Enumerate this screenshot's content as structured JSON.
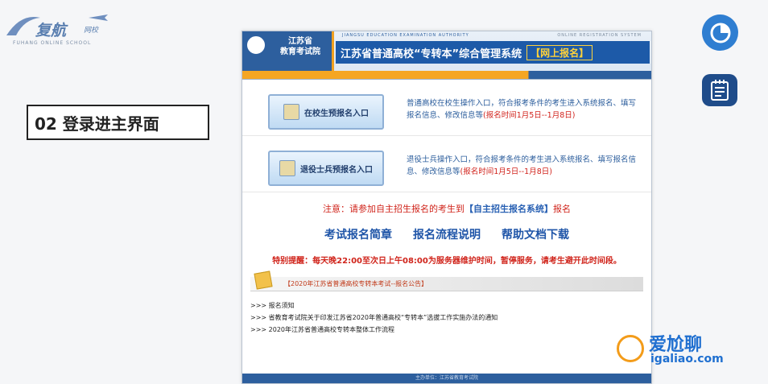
{
  "logo": {
    "brand": "复航",
    "badge": "网校",
    "sub": "FUHANG ONLINE SCHOOL"
  },
  "step_label": "02 登录进主界面",
  "header": {
    "org_line1": "江苏省",
    "org_line2": "教育考试院",
    "eng_left": "JIANGSU EDUCATION EXAMINATION AUTHORITY",
    "eng_right": "ONLINE REGISTRATION SYSTEM",
    "title": "江苏省普通高校“专转本”综合管理系统",
    "online_tag": "【网上报名】"
  },
  "entries": [
    {
      "label": "在校生预报名入口",
      "desc": "普通高校在校生操作入口，符合报考条件的考生进入系统报名、填写报名信息、修改信息等",
      "time": "(报名时间1月5日--1月8日)"
    },
    {
      "label": "退役士兵预报名入口",
      "desc": "退役士兵操作入口，符合报考条件的考生进入系统报名、填写报名信息、修改信息等",
      "time": "(报名时间1月5日--1月8日)"
    }
  ],
  "notice": {
    "prefix": "注意：请参加自主招生报名的考生到",
    "link": "【自主招生报名系统】",
    "suffix": "报名"
  },
  "links": [
    "考试报名简章",
    "报名流程说明",
    "帮助文档下载"
  ],
  "warning": "特别提醒：每天晚22:00至次日上午08:00为服务器维护时间，暂停服务，请考生避开此时间段。",
  "announcement_title": "【2020年江苏省普通高校专转本考试--报名公告】",
  "news": [
    ">>> 报名须知",
    ">>> 省教育考试院关于印发江苏省2020年普通高校“专转本”选拔工作实施办法的通知",
    ">>> 2020年江苏省普通高校专转本整体工作流程"
  ],
  "footer": "主办单位：江苏省教育考试院",
  "watermark": {
    "line1": "爱尬聊",
    "line2": "igaliao.com"
  },
  "colors": {
    "accent": "#1d5aa8",
    "warning": "#d0241b",
    "header_stripe": "#f5a623"
  }
}
